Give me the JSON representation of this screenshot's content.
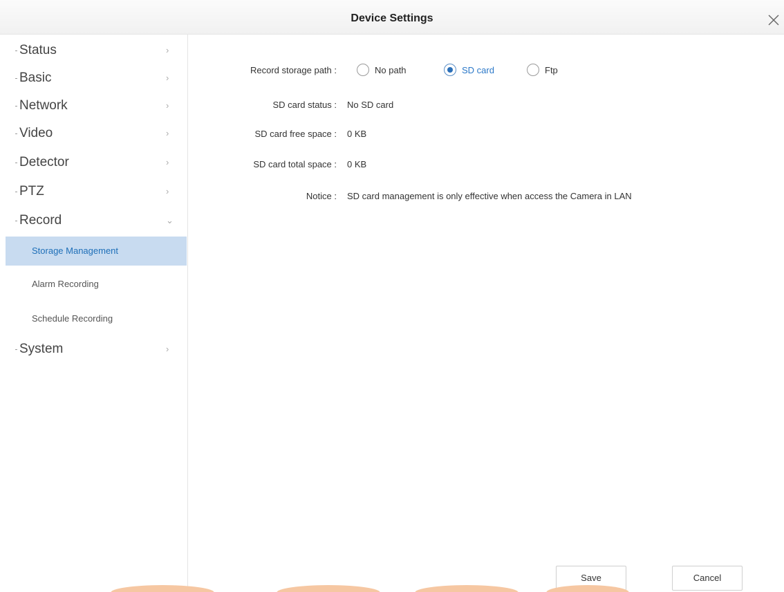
{
  "window": {
    "title": "Device Settings"
  },
  "sidebar": {
    "items": [
      {
        "label": "Status",
        "chevron": "›"
      },
      {
        "label": "Basic",
        "chevron": "›"
      },
      {
        "label": "Network",
        "chevron": "›"
      },
      {
        "label": "Video",
        "chevron": "›"
      },
      {
        "label": "Detector",
        "chevron": "›"
      },
      {
        "label": "PTZ",
        "chevron": "›"
      },
      {
        "label": "Record",
        "chevron": "⌄",
        "expanded": true
      },
      {
        "label": "System",
        "chevron": "›"
      }
    ],
    "record_subitems": [
      {
        "label": "Storage Management",
        "active": true
      },
      {
        "label": "Alarm Recording",
        "active": false
      },
      {
        "label": "Schedule Recording",
        "active": false
      }
    ]
  },
  "main": {
    "record_storage_path": {
      "label": "Record storage path :",
      "options": [
        {
          "label": "No path",
          "selected": false
        },
        {
          "label": "SD card",
          "selected": true
        },
        {
          "label": "Ftp",
          "selected": false
        }
      ]
    },
    "sd_card_status": {
      "label": "SD card status :",
      "value": "No SD card"
    },
    "sd_card_free_space": {
      "label": "SD card free space :",
      "value": "0 KB"
    },
    "sd_card_total_space": {
      "label": "SD card total space :",
      "value": "0 KB"
    },
    "notice": {
      "label": "Notice :",
      "value": "SD card management is only effective when access the Camera in LAN"
    }
  },
  "footer": {
    "save_label": "Save",
    "cancel_label": "Cancel"
  },
  "colors": {
    "active_bg": "#c8dbf0",
    "active_text": "#1e6fb8",
    "accent": "#2b6fb8",
    "brand_deco": "#f6c7a2"
  },
  "icons": {
    "close": "close-icon",
    "chevron_right": "chevron-right-icon",
    "chevron_down": "chevron-down-icon"
  }
}
